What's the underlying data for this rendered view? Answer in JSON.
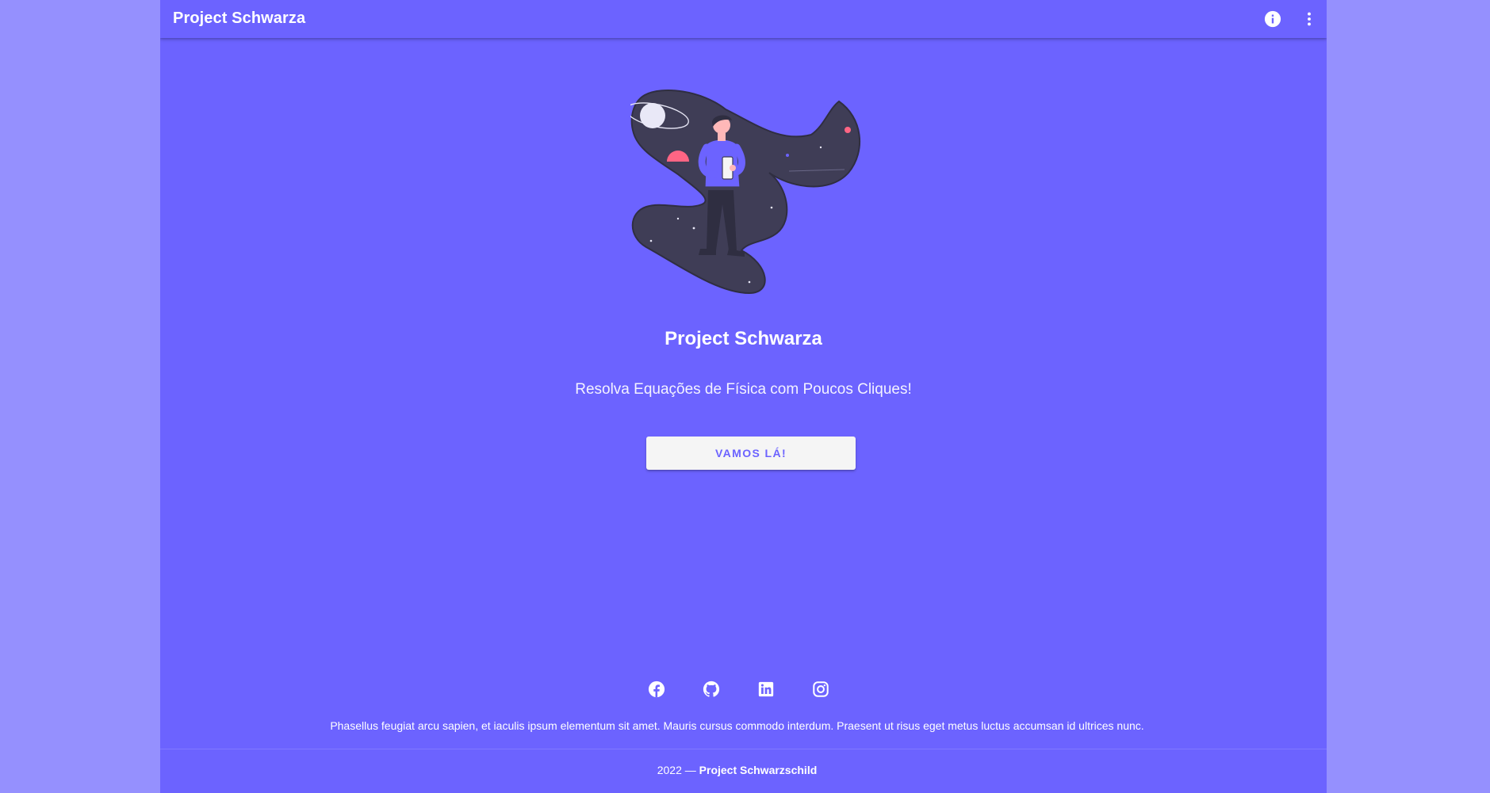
{
  "colors": {
    "page_background": "#9590fe",
    "primary": "#6c63ff",
    "button_background": "#f5f5f5",
    "illustration_dark": "#3f3d56",
    "illustration_accent": "#ff6584"
  },
  "app_bar": {
    "title": "Project Schwarza",
    "actions": [
      {
        "icon": "info-icon"
      },
      {
        "icon": "more-vert-icon"
      }
    ]
  },
  "hero": {
    "illustration": "person-in-space-illustration",
    "title": "Project Schwarza",
    "subtitle": "Resolva Equações de Física com Poucos Cliques!",
    "cta_label": "VAMOS LÁ!"
  },
  "footer": {
    "social_icons": [
      "facebook-icon",
      "github-icon",
      "linkedin-icon",
      "instagram-icon"
    ],
    "text": "Phasellus feugiat arcu sapien, et iaculis ipsum elementum sit amet. Mauris cursus commodo interdum. Praesent ut risus eget metus luctus accumsan id ultrices nunc.",
    "year": "2022 —",
    "project_name": "Project Schwarzschild"
  }
}
